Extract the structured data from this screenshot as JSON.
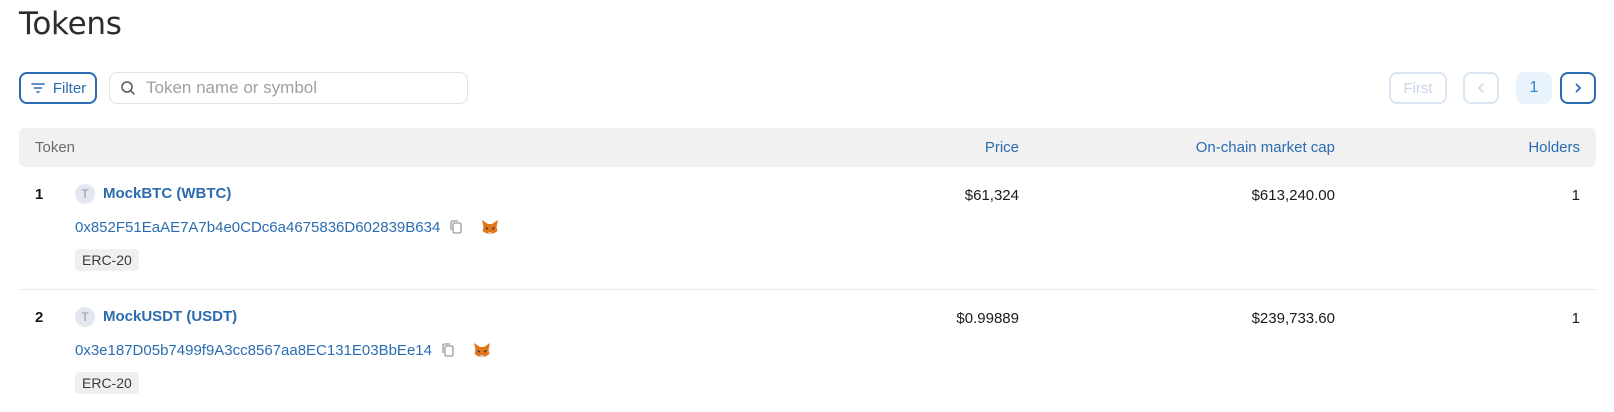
{
  "page": {
    "title": "Tokens"
  },
  "toolbar": {
    "filter_label": "Filter",
    "search_placeholder": "Token name or symbol",
    "search_value": ""
  },
  "pagination": {
    "first_label": "First",
    "current_page": "1"
  },
  "table": {
    "headers": {
      "token": "Token",
      "price": "Price",
      "market_cap": "On-chain market cap",
      "holders": "Holders"
    },
    "rows": [
      {
        "index": "1",
        "icon_letter": "T",
        "name": "MockBTC (WBTC)",
        "address": "0x852F51EaAE7A7b4e0CDc6a4675836D602839B634",
        "type": "ERC-20",
        "price": "$61,324",
        "market_cap": "$613,240.00",
        "holders": "1"
      },
      {
        "index": "2",
        "icon_letter": "T",
        "name": "MockUSDT (USDT)",
        "address": "0x3e187D05b7499f9A3cc8567aa8EC131E03BbEe14",
        "type": "ERC-20",
        "price": "$0.99889",
        "market_cap": "$239,733.60",
        "holders": "1"
      }
    ]
  },
  "colors": {
    "accent": "#2b6cb0",
    "header_bg": "#f1f1f1",
    "badge_bg": "#efefef"
  }
}
